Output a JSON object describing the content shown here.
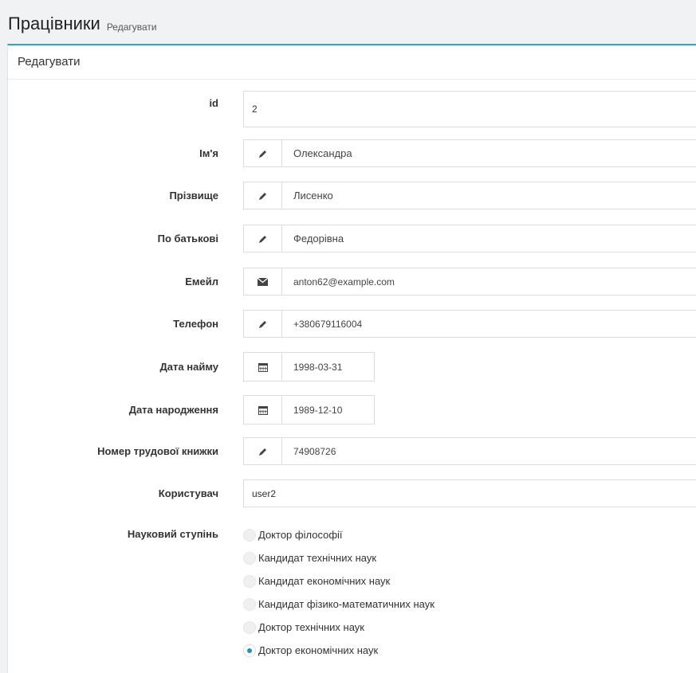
{
  "header": {
    "title": "Працівники",
    "subtitle": "Редагувати"
  },
  "panel": {
    "heading": "Редагувати"
  },
  "fields": {
    "id": {
      "label": "id",
      "value": "2"
    },
    "first_name": {
      "label": "Ім'я",
      "value": "Олександра",
      "icon": "pencil-icon"
    },
    "last_name": {
      "label": "Прізвище",
      "value": "Лисенко",
      "icon": "pencil-icon"
    },
    "patronymic": {
      "label": "По батькові",
      "value": "Федорівна",
      "icon": "pencil-icon"
    },
    "email": {
      "label": "Емейл",
      "value": "anton62@example.com",
      "icon": "envelope-icon"
    },
    "phone": {
      "label": "Телефон",
      "value": "+380679116004",
      "icon": "pencil-icon"
    },
    "hire_date": {
      "label": "Дата найму",
      "value": "1998-03-31",
      "icon": "calendar-icon"
    },
    "birth_date": {
      "label": "Дата народження",
      "value": "1989-12-10",
      "icon": "calendar-icon"
    },
    "work_book": {
      "label": "Номер трудової книжки",
      "value": "74908726",
      "icon": "pencil-icon"
    },
    "user": {
      "label": "Користувач",
      "value": "user2"
    }
  },
  "degree": {
    "label": "Науковий ступінь",
    "options": [
      "Доктор філософії",
      "Кандидат технічних наук",
      "Кандидат економічних наук",
      "Кандидат фізико-математичних наук",
      "Доктор технічних наук",
      "Доктор економічних наук"
    ],
    "selected": "Доктор економічних наук"
  },
  "colors": {
    "accent": "#21a8d7",
    "radio_selected": "#1f8ed0"
  }
}
